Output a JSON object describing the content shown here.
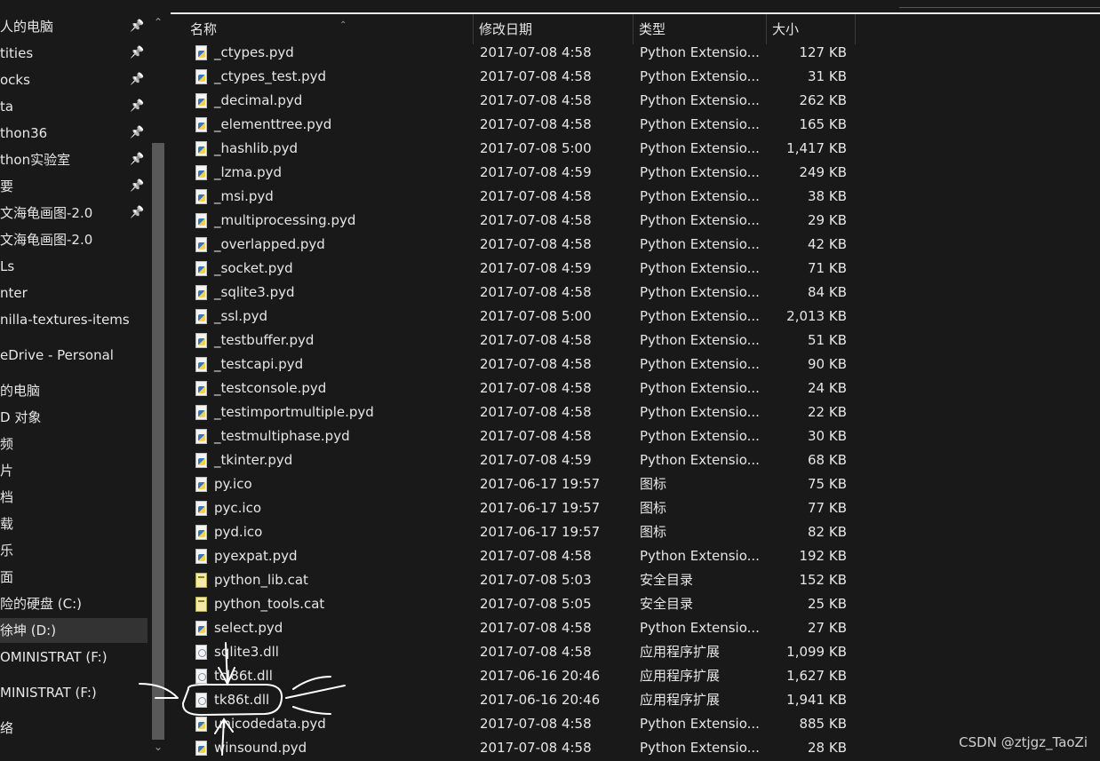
{
  "nav_items": [
    {
      "label": "人的电脑",
      "pinned": true
    },
    {
      "label": "tities",
      "pinned": true
    },
    {
      "label": "ocks",
      "pinned": true
    },
    {
      "label": "ta",
      "pinned": true
    },
    {
      "label": "thon36",
      "pinned": true
    },
    {
      "label": "thon实验室",
      "pinned": true
    },
    {
      "label": "要",
      "pinned": true
    },
    {
      "label": "文海龟画图-2.0",
      "pinned": true
    },
    {
      "label": "文海龟画图-2.0",
      "pinned": false
    },
    {
      "label": "Ls",
      "pinned": false
    },
    {
      "label": "nter",
      "pinned": false
    },
    {
      "label": "nilla-textures-items",
      "pinned": false
    },
    {
      "label": "eDrive - Personal",
      "pinned": false
    },
    {
      "label": "的电脑",
      "pinned": false
    },
    {
      "label": "D 对象",
      "pinned": false
    },
    {
      "label": "频",
      "pinned": false
    },
    {
      "label": "片",
      "pinned": false
    },
    {
      "label": "档",
      "pinned": false
    },
    {
      "label": "载",
      "pinned": false
    },
    {
      "label": "乐",
      "pinned": false
    },
    {
      "label": "面",
      "pinned": false
    },
    {
      "label": "险的硬盘 (C:)",
      "pinned": false
    },
    {
      "label": "徐坤 (D:)",
      "pinned": false,
      "selected": true
    },
    {
      "label": "OMINISTRAT (F:)",
      "pinned": false
    },
    {
      "label": "MINISTRAT (F:)",
      "pinned": false
    },
    {
      "label": "络",
      "pinned": false
    }
  ],
  "columns": {
    "name": "名称",
    "date": "修改日期",
    "type": "类型",
    "size": "大小"
  },
  "files": [
    {
      "name": "_ctypes.pyd",
      "date": "2017-07-08 4:58",
      "type": "Python Extensio...",
      "size": "127 KB",
      "icon": "py"
    },
    {
      "name": "_ctypes_test.pyd",
      "date": "2017-07-08 4:58",
      "type": "Python Extensio...",
      "size": "31 KB",
      "icon": "py"
    },
    {
      "name": "_decimal.pyd",
      "date": "2017-07-08 4:58",
      "type": "Python Extensio...",
      "size": "262 KB",
      "icon": "py"
    },
    {
      "name": "_elementtree.pyd",
      "date": "2017-07-08 4:58",
      "type": "Python Extensio...",
      "size": "165 KB",
      "icon": "py"
    },
    {
      "name": "_hashlib.pyd",
      "date": "2017-07-08 5:00",
      "type": "Python Extensio...",
      "size": "1,417 KB",
      "icon": "py"
    },
    {
      "name": "_lzma.pyd",
      "date": "2017-07-08 4:59",
      "type": "Python Extensio...",
      "size": "249 KB",
      "icon": "py"
    },
    {
      "name": "_msi.pyd",
      "date": "2017-07-08 4:58",
      "type": "Python Extensio...",
      "size": "38 KB",
      "icon": "py"
    },
    {
      "name": "_multiprocessing.pyd",
      "date": "2017-07-08 4:58",
      "type": "Python Extensio...",
      "size": "29 KB",
      "icon": "py"
    },
    {
      "name": "_overlapped.pyd",
      "date": "2017-07-08 4:58",
      "type": "Python Extensio...",
      "size": "42 KB",
      "icon": "py"
    },
    {
      "name": "_socket.pyd",
      "date": "2017-07-08 4:59",
      "type": "Python Extensio...",
      "size": "71 KB",
      "icon": "py"
    },
    {
      "name": "_sqlite3.pyd",
      "date": "2017-07-08 4:58",
      "type": "Python Extensio...",
      "size": "84 KB",
      "icon": "py"
    },
    {
      "name": "_ssl.pyd",
      "date": "2017-07-08 5:00",
      "type": "Python Extensio...",
      "size": "2,013 KB",
      "icon": "py"
    },
    {
      "name": "_testbuffer.pyd",
      "date": "2017-07-08 4:58",
      "type": "Python Extensio...",
      "size": "51 KB",
      "icon": "py"
    },
    {
      "name": "_testcapi.pyd",
      "date": "2017-07-08 4:58",
      "type": "Python Extensio...",
      "size": "90 KB",
      "icon": "py"
    },
    {
      "name": "_testconsole.pyd",
      "date": "2017-07-08 4:58",
      "type": "Python Extensio...",
      "size": "24 KB",
      "icon": "py"
    },
    {
      "name": "_testimportmultiple.pyd",
      "date": "2017-07-08 4:58",
      "type": "Python Extensio...",
      "size": "22 KB",
      "icon": "py"
    },
    {
      "name": "_testmultiphase.pyd",
      "date": "2017-07-08 4:58",
      "type": "Python Extensio...",
      "size": "30 KB",
      "icon": "py"
    },
    {
      "name": "_tkinter.pyd",
      "date": "2017-07-08 4:59",
      "type": "Python Extensio...",
      "size": "68 KB",
      "icon": "py"
    },
    {
      "name": "py.ico",
      "date": "2017-06-17 19:57",
      "type": "图标",
      "size": "75 KB",
      "icon": "py"
    },
    {
      "name": "pyc.ico",
      "date": "2017-06-17 19:57",
      "type": "图标",
      "size": "77 KB",
      "icon": "py"
    },
    {
      "name": "pyd.ico",
      "date": "2017-06-17 19:57",
      "type": "图标",
      "size": "82 KB",
      "icon": "py"
    },
    {
      "name": "pyexpat.pyd",
      "date": "2017-07-08 4:58",
      "type": "Python Extensio...",
      "size": "192 KB",
      "icon": "py"
    },
    {
      "name": "python_lib.cat",
      "date": "2017-07-08 5:03",
      "type": "安全目录",
      "size": "152 KB",
      "icon": "cat"
    },
    {
      "name": "python_tools.cat",
      "date": "2017-07-08 5:05",
      "type": "安全目录",
      "size": "25 KB",
      "icon": "cat"
    },
    {
      "name": "select.pyd",
      "date": "2017-07-08 4:58",
      "type": "Python Extensio...",
      "size": "27 KB",
      "icon": "py"
    },
    {
      "name": "sqlite3.dll",
      "date": "2017-07-08 4:58",
      "type": "应用程序扩展",
      "size": "1,099 KB",
      "icon": "dll"
    },
    {
      "name": "tcl86t.dll",
      "date": "2017-06-16 20:46",
      "type": "应用程序扩展",
      "size": "1,627 KB",
      "icon": "dll"
    },
    {
      "name": "tk86t.dll",
      "date": "2017-06-16 20:46",
      "type": "应用程序扩展",
      "size": "1,941 KB",
      "icon": "dll"
    },
    {
      "name": "unicodedata.pyd",
      "date": "2017-07-08 4:58",
      "type": "Python Extensio...",
      "size": "885 KB",
      "icon": "py"
    },
    {
      "name": "winsound.pyd",
      "date": "2017-07-08 4:58",
      "type": "Python Extensio...",
      "size": "28 KB",
      "icon": "py"
    }
  ],
  "watermark": "CSDN @ztjgz_TaoZi",
  "icons": {
    "pin": "pin-icon",
    "scroll_up": "chevron-up-icon",
    "scroll_down": "chevron-down-icon",
    "sort": "sort-ascending-icon"
  },
  "colors": {
    "background": "#191919",
    "text": "#e6e6e6",
    "selected": "#333333",
    "annotation": "#ffffff"
  }
}
